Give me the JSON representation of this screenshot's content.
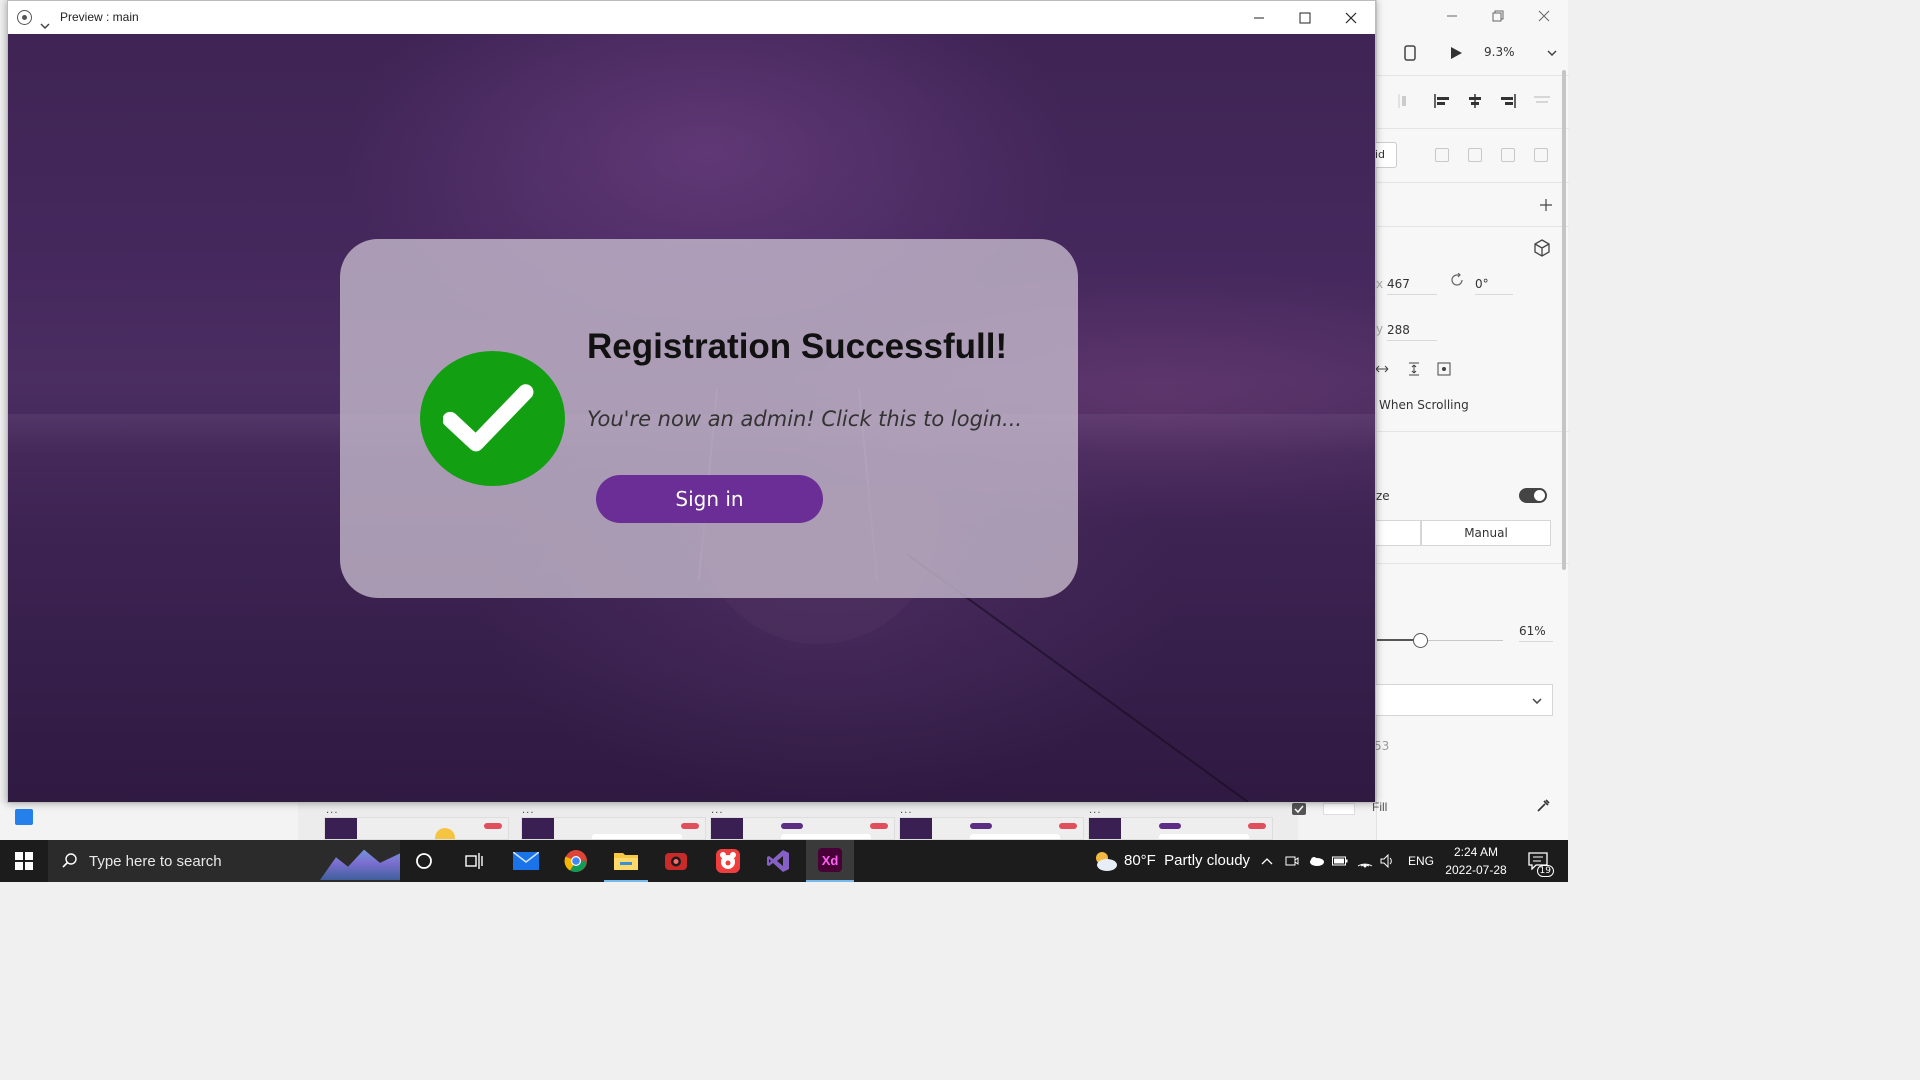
{
  "preview_window": {
    "title": "Preview : main"
  },
  "dialog": {
    "title": "Registration Successfull!",
    "message": "You're now an admin! Click this to login...",
    "signin_label": "Sign in"
  },
  "xd_panel": {
    "zoom": "9.3%",
    "grid_button_fragment": "id",
    "x_label": "x",
    "x_value": "467",
    "y_label": "y",
    "y_value": "288",
    "rotation": "0°",
    "fixed_text": "When Scrolling",
    "responsive_fragment": "ze",
    "manual_label": "Manual",
    "opacity": "61%",
    "opacity_level": 0.61,
    "size_fragment": "53",
    "fill_label": "Fill",
    "fill_checked": true
  },
  "taskbar": {
    "search_placeholder": "Type here to search",
    "weather": "80°F  Partly cloudy",
    "language": "ENG",
    "time": "2:24 AM",
    "date": "2022-07-28",
    "notification_count": "19",
    "apps": [
      "cortana",
      "task-view",
      "mail",
      "chrome",
      "file-explorer",
      "screen-recorder",
      "app-red",
      "visual-studio",
      "adobe-xd"
    ],
    "xd_label": "Xd"
  },
  "colors": {
    "accent_purple": "#6a2e96",
    "success_green": "#12a012",
    "xd_magenta": "#ff61f6",
    "taskbar_bg": "#1c1c1c"
  }
}
